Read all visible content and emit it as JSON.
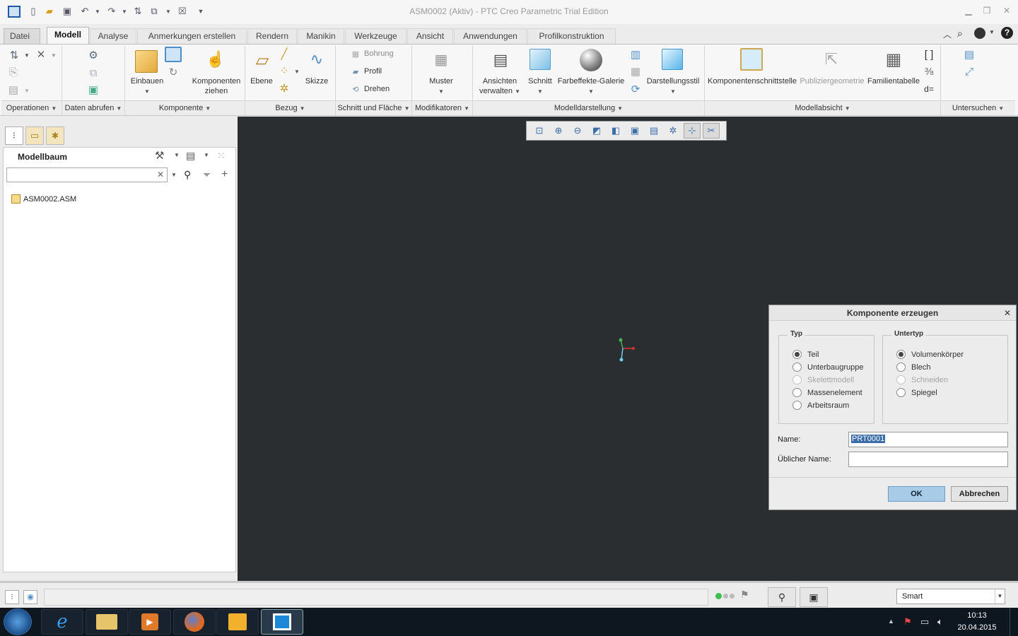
{
  "window": {
    "title": "ASM0002 (Aktiv) - PTC Creo Parametric Trial Edition"
  },
  "tabs": [
    {
      "label": "Datei"
    },
    {
      "label": "Modell"
    },
    {
      "label": "Analyse"
    },
    {
      "label": "Anmerkungen erstellen"
    },
    {
      "label": "Rendern"
    },
    {
      "label": "Manikin"
    },
    {
      "label": "Werkzeuge"
    },
    {
      "label": "Ansicht"
    },
    {
      "label": "Anwendungen"
    },
    {
      "label": "Profilkonstruktion"
    }
  ],
  "ribbon": {
    "buttons": {
      "einbauen": "Einbauen",
      "komponenten_1": "Komponenten",
      "komponenten_2": "ziehen",
      "ebene": "Ebene",
      "skizze": "Skizze",
      "bohrung": "Bohrung",
      "profil": "Profil",
      "drehen": "Drehen",
      "muster": "Muster",
      "ansichten_1": "Ansichten",
      "ansichten_2": "verwalten",
      "schnitt": "Schnitt",
      "farbeffekte": "Farbeffekte-Galerie",
      "darstellungsstil": "Darstellungsstil",
      "komponentenschnittstelle": "Komponentenschnittstelle",
      "publiziergeometrie": "Publiziergeometrie",
      "familientabelle": "Familientabelle"
    },
    "groups": [
      {
        "label": "Operationen"
      },
      {
        "label": "Daten abrufen"
      },
      {
        "label": "Komponente"
      },
      {
        "label": "Bezug"
      },
      {
        "label": "Schnitt und Fläche"
      },
      {
        "label": "Modifikatoren"
      },
      {
        "label": "Modelldarstellung"
      },
      {
        "label": "Modellabsicht"
      },
      {
        "label": "Untersuchen"
      }
    ]
  },
  "model_tree": {
    "title": "Modellbaum",
    "search_value": "",
    "items": [
      {
        "label": "ASM0002.ASM"
      }
    ]
  },
  "dialog": {
    "title": "Komponente erzeugen",
    "typ_legend": "Typ",
    "typ_options": [
      {
        "label": "Teil",
        "selected": true,
        "enabled": true
      },
      {
        "label": "Unterbaugruppe",
        "selected": false,
        "enabled": true
      },
      {
        "label": "Skelettmodell",
        "selected": false,
        "enabled": false
      },
      {
        "label": "Massenelement",
        "selected": false,
        "enabled": true
      },
      {
        "label": "Arbeitsraum",
        "selected": false,
        "enabled": true
      }
    ],
    "untertyp_legend": "Untertyp",
    "untertyp_options": [
      {
        "label": "Volumenkörper",
        "selected": true,
        "enabled": true
      },
      {
        "label": "Blech",
        "selected": false,
        "enabled": true
      },
      {
        "label": "Schneiden",
        "selected": false,
        "enabled": false
      },
      {
        "label": "Spiegel",
        "selected": false,
        "enabled": true
      }
    ],
    "name_label": "Name:",
    "name_value": "PRT0001",
    "common_name_label": "Üblicher Name:",
    "common_name_value": "",
    "ok_label": "OK",
    "cancel_label": "Abbrechen"
  },
  "statusbar": {
    "filter_value": "Smart"
  },
  "taskbar": {
    "time": "10:13",
    "date": "20.04.2015"
  },
  "colors": {
    "viewport_bg": "#2b2e30",
    "accent": "#3b6ea8",
    "ok_button": "#a8cbe8"
  }
}
